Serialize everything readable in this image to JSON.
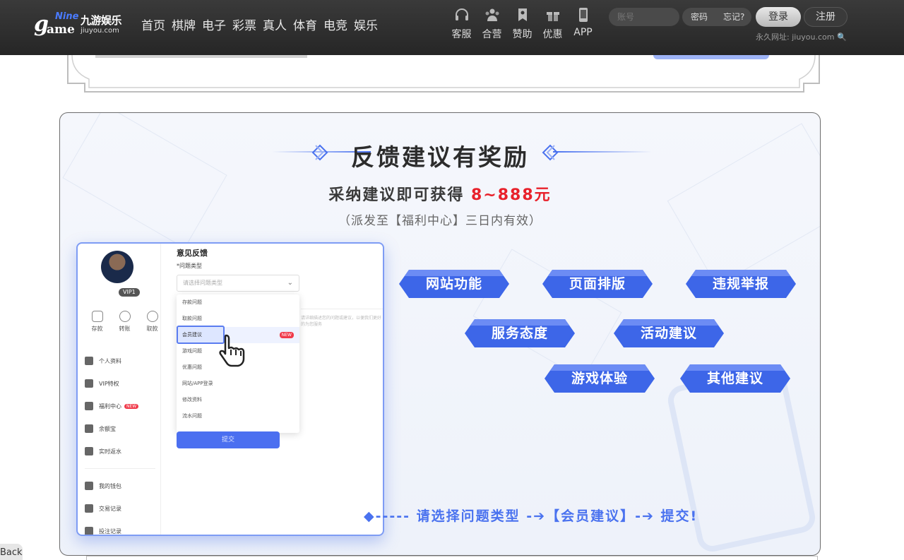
{
  "header": {
    "logo": {
      "nine": "Nine",
      "g": "g",
      "ame": "ame",
      "cn": "九游娱乐",
      "domain": "jiuyou.com"
    },
    "nav": [
      "首页",
      "棋牌",
      "电子",
      "彩票",
      "真人",
      "体育",
      "电竞",
      "娱乐"
    ],
    "quick_links": [
      {
        "label": "客服",
        "icon": "headset-icon"
      },
      {
        "label": "合营",
        "icon": "partner-icon"
      },
      {
        "label": "赞助",
        "icon": "bookmark-icon"
      },
      {
        "label": "优惠",
        "icon": "gift-icon"
      },
      {
        "label": "APP",
        "icon": "phone-icon"
      }
    ],
    "account_placeholder": "账号",
    "password_placeholder": "密码",
    "forgot": "忘记?",
    "login": "登录",
    "register": "注册",
    "permanent_url": "永久网址: jiuyou.com"
  },
  "card": {
    "title": "反馈建议有奖励",
    "subtitle_prefix": "采纳建议即可获得",
    "subtitle_amount": "8~888元",
    "note": "（派发至【福利中心】三日内有效）",
    "options": [
      "网站功能",
      "页面排版",
      "违规举报",
      "服务态度",
      "活动建议",
      "游戏体验",
      "其他建议"
    ],
    "instruction": "◆-----  请选择问题类型  -➔【会员建议】-➔ 提交!"
  },
  "mock": {
    "vip": "VIP1",
    "quick": [
      "存款",
      "转账",
      "取款"
    ],
    "menu": [
      {
        "label": "个人资料",
        "new": false
      },
      {
        "label": "VIP特权",
        "new": false
      },
      {
        "label": "福利中心",
        "new": true
      },
      {
        "label": "余额宝",
        "new": false
      },
      {
        "label": "实时返水",
        "new": false
      }
    ],
    "menu2": [
      "我的钱包",
      "交易记录",
      "投注记录"
    ],
    "new_badge": "NEW",
    "title": "意见反馈",
    "field_label": "*问题类型",
    "select_placeholder": "请选择问题类型",
    "dropdown": [
      "存款问题",
      "取款问题",
      "会员建议",
      "游戏问题",
      "优惠问题",
      "网站/APP登录",
      "修改资料",
      "流水问题"
    ],
    "hint": "请详细描述您的问题或建议，以便我们更好的为您服务",
    "submit": "提交"
  },
  "footer": {
    "back": "Back"
  },
  "colors": {
    "accent": "#4a72ef",
    "amount": "#e8212b",
    "header_bg": "#2e2e2e"
  }
}
